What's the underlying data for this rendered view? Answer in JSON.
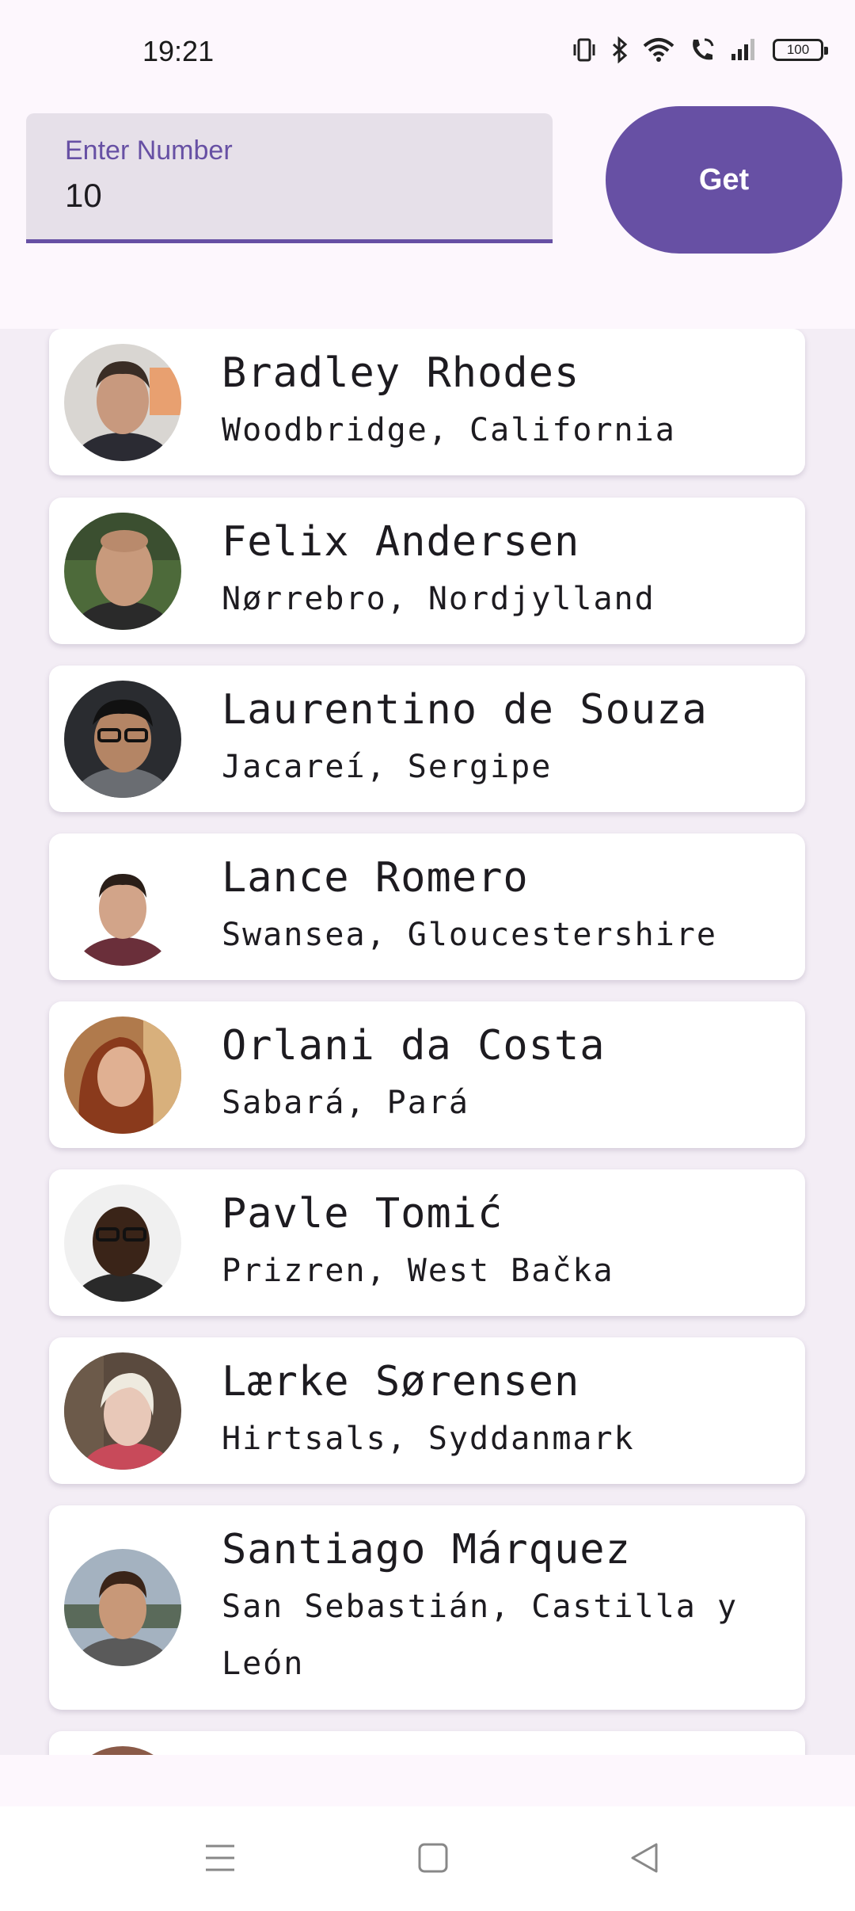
{
  "status_bar": {
    "time": "19:21",
    "icons": [
      "vibrate-icon",
      "bluetooth-icon",
      "wifi-icon",
      "wifi-call-icon",
      "signal-icon",
      "battery-icon"
    ],
    "battery_level": "100"
  },
  "search": {
    "label": "Enter Number",
    "value": "10"
  },
  "get_button": {
    "label": "Get"
  },
  "colors": {
    "primary": "#6750a4",
    "input_bg": "#e6e0e9",
    "background": "#fdf7fd"
  },
  "people": [
    {
      "name": "Bradley Rhodes",
      "location": "Woodbridge, California"
    },
    {
      "name": "Felix Andersen",
      "location": "Nørrebro, Nordjylland"
    },
    {
      "name": "Laurentino de Souza",
      "location": "Jacareí, Sergipe"
    },
    {
      "name": "Lance Romero",
      "location": "Swansea, Gloucestershire"
    },
    {
      "name": "Orlani da Costa",
      "location": "Sabará, Pará"
    },
    {
      "name": "Pavle Tomić",
      "location": "Prizren, West Bačka"
    },
    {
      "name": "Lærke Sørensen",
      "location": "Hirtsals, Syddanmark"
    },
    {
      "name": "Santiago Márquez",
      "location": "San Sebastián, Castilla y León"
    }
  ],
  "nav_bar": {
    "items": [
      "menu-icon",
      "home-icon",
      "back-icon"
    ]
  }
}
